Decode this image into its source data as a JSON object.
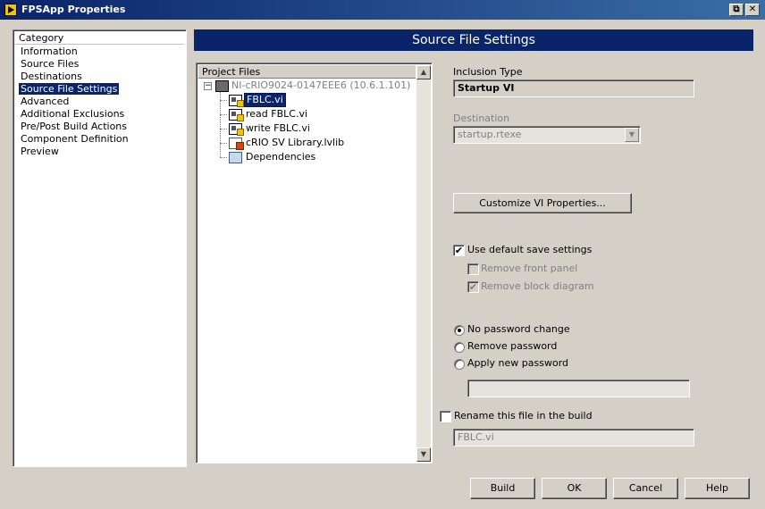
{
  "window": {
    "title": "FPSApp Properties",
    "icon": "labview-app-icon",
    "restore_glyph": "⧉",
    "close_glyph": "✕"
  },
  "category": {
    "header": "Category",
    "items": [
      {
        "label": "Information"
      },
      {
        "label": "Source Files"
      },
      {
        "label": "Destinations"
      },
      {
        "label": "Source File Settings"
      },
      {
        "label": "Advanced"
      },
      {
        "label": "Additional Exclusions"
      },
      {
        "label": "Pre/Post Build Actions"
      },
      {
        "label": "Component Definition"
      },
      {
        "label": "Preview"
      }
    ],
    "selected": "Source File Settings"
  },
  "page": {
    "title": "Source File Settings"
  },
  "project_files": {
    "header": "Project Files",
    "expander_glyph": "−",
    "scroll_up": "▲",
    "scroll_down": "▼",
    "tree": [
      {
        "label": "NI-cRIO9024-0147EEE6 (10.6.1.101)",
        "icon": "target-icon"
      },
      {
        "label": "FBLC.vi",
        "icon": "vi-icon"
      },
      {
        "label": "read FBLC.vi",
        "icon": "vi-icon"
      },
      {
        "label": "write FBLC.vi",
        "icon": "vi-icon"
      },
      {
        "label": "cRIO SV Library.lvlib",
        "icon": "library-icon"
      },
      {
        "label": "Dependencies",
        "icon": "dependencies-icon"
      }
    ]
  },
  "settings": {
    "inclusion_type_label": "Inclusion Type",
    "inclusion_type_value": "Startup VI",
    "destination_label": "Destination",
    "destination_value": "startup.rtexe",
    "dropdown_glyph": "▼",
    "customize_button": "Customize VI Properties...",
    "check_glyph": "✔",
    "use_default_save": "Use default save settings",
    "use_default_save_checked": true,
    "remove_front_panel": "Remove front panel",
    "remove_front_panel_checked": false,
    "remove_block_diagram": "Remove block diagram",
    "remove_block_diagram_checked": true,
    "password_options": [
      {
        "label": "No password change",
        "checked": true
      },
      {
        "label": "Remove password",
        "checked": false
      },
      {
        "label": "Apply new password",
        "checked": false
      }
    ],
    "new_password_value": "",
    "rename_label": "Rename this file in the build",
    "rename_checked": false,
    "rename_value": "FBLC.vi"
  },
  "buttons": {
    "build": "Build",
    "ok": "OK",
    "cancel": "Cancel",
    "help": "Help"
  }
}
